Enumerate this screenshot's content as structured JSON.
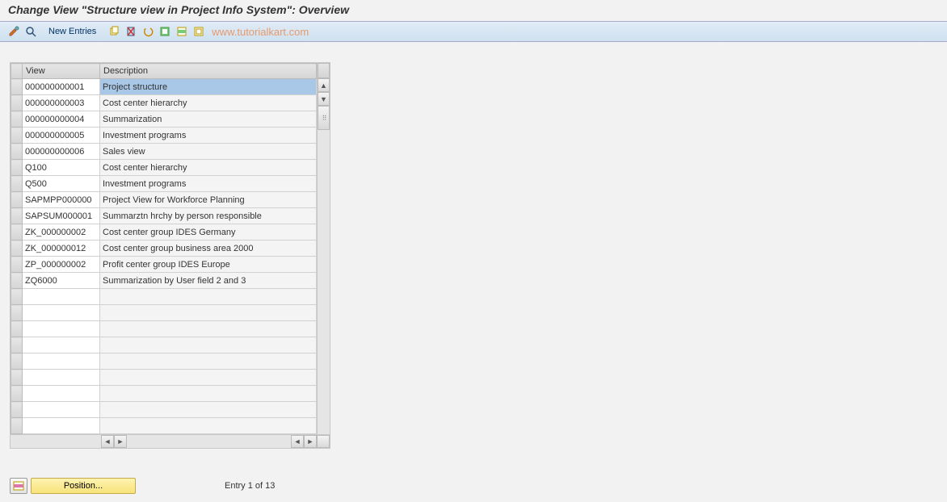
{
  "title": "Change View \"Structure view in Project Info System\": Overview",
  "toolbar": {
    "new_entries_label": "New Entries",
    "watermark": "www.tutorialkart.com"
  },
  "table": {
    "headers": {
      "view": "View",
      "description": "Description"
    },
    "rows": [
      {
        "view": "000000000001",
        "description": "Project structure",
        "selected": true
      },
      {
        "view": "000000000003",
        "description": "Cost center hierarchy"
      },
      {
        "view": "000000000004",
        "description": "Summarization"
      },
      {
        "view": "000000000005",
        "description": "Investment programs"
      },
      {
        "view": "000000000006",
        "description": "Sales view"
      },
      {
        "view": "Q100",
        "description": "Cost center hierarchy"
      },
      {
        "view": "Q500",
        "description": "Investment programs"
      },
      {
        "view": "SAPMPP000000",
        "description": "Project View for Workforce Planning"
      },
      {
        "view": "SAPSUM000001",
        "description": "Summarztn hrchy by person responsible"
      },
      {
        "view": "ZK_000000002",
        "description": "Cost center group IDES Germany"
      },
      {
        "view": "ZK_000000012",
        "description": "Cost center group business area 2000"
      },
      {
        "view": "ZP_000000002",
        "description": "Profit center group IDES Europe"
      },
      {
        "view": "ZQ6000",
        "description": "Summarization by User field 2 and 3"
      }
    ],
    "empty_rows": 9
  },
  "footer": {
    "position_label": "Position...",
    "entry_text": "Entry 1 of 13"
  }
}
